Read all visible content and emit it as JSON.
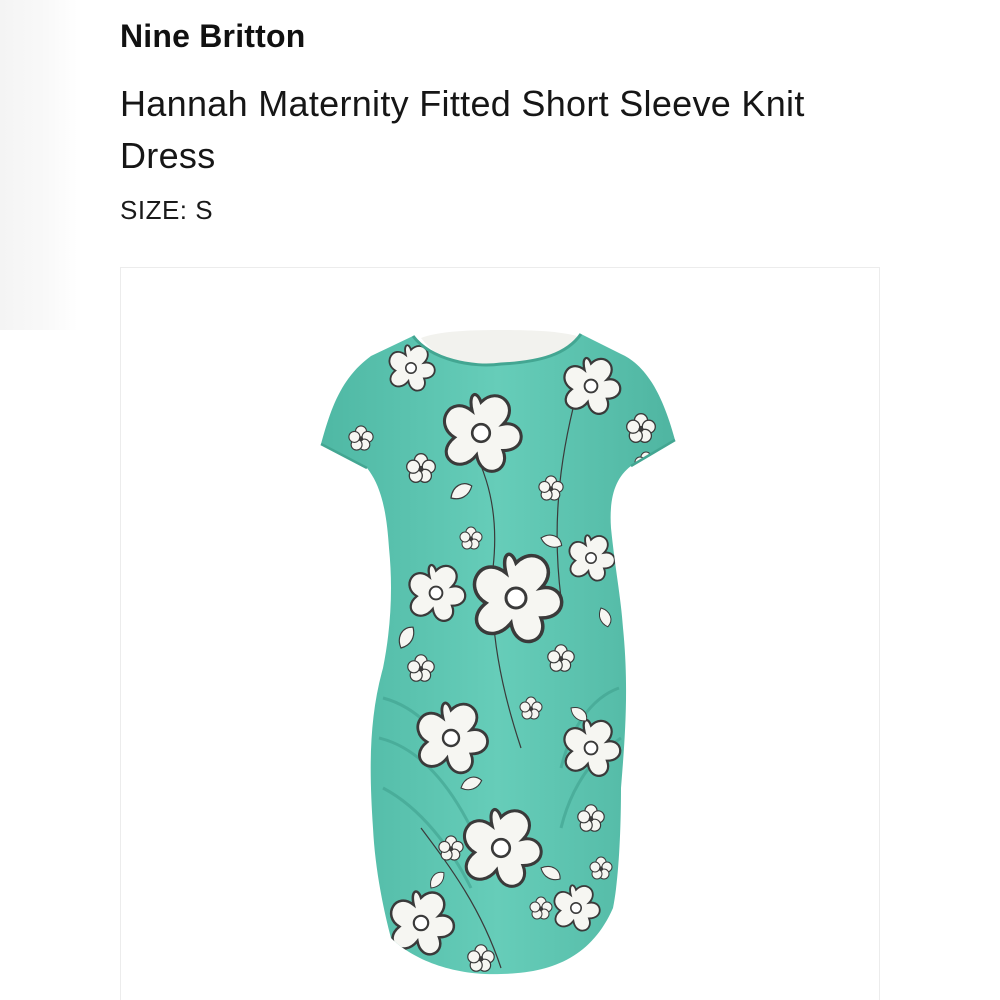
{
  "product": {
    "brand": "Nine Britton",
    "title": "Hannah Maternity Fitted Short Sleeve Knit Dress",
    "size_label": "SIZE:",
    "size_value": "S"
  },
  "image": {
    "subject": "floral-dress",
    "colors": {
      "dress_base": "#5ec8b4",
      "dress_shade": "#48b09c",
      "flower_fill": "#f6f6f2",
      "flower_line": "#3a3a3a",
      "lining": "#f2f2ee"
    }
  }
}
